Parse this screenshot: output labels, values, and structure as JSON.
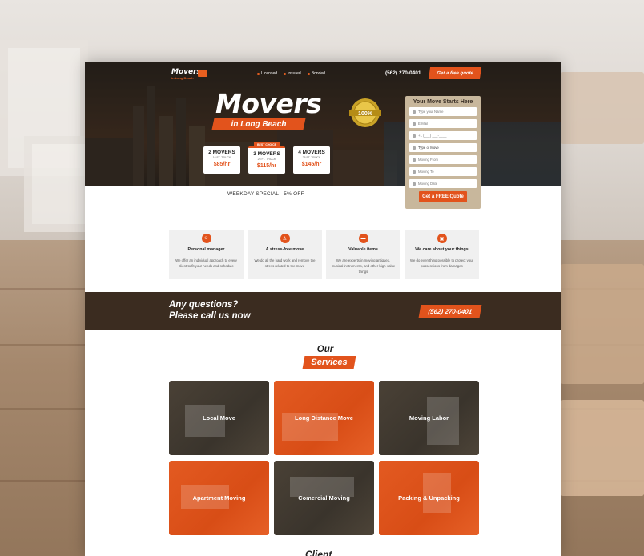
{
  "nav": {
    "logo_title": "Movers",
    "logo_sub": "in Long Beach",
    "tags": [
      "Licensed",
      "Insured",
      "Bonded"
    ],
    "phone": "(562) 270-0401",
    "quote_button": "Get a free quote"
  },
  "hero": {
    "title": "Movers",
    "subtitle": "in Long Beach",
    "badge_text": "100%",
    "special": "WEEKDAY SPECIAL - 5% OFF",
    "prices": [
      {
        "movers": "2 MOVERS",
        "truck": "16 FT. TRUCK",
        "price": "$85/hr",
        "tag": ""
      },
      {
        "movers": "3 MOVERS",
        "truck": "26 FT. TRUCK",
        "price": "$115/hr",
        "tag": "BEST CHOICE"
      },
      {
        "movers": "4 MOVERS",
        "truck": "26 FT. TRUCK",
        "price": "$145/hr",
        "tag": ""
      }
    ]
  },
  "form": {
    "title": "Your Move Starts Here",
    "fields": [
      {
        "placeholder": "Type your Name",
        "icon": "user-icon"
      },
      {
        "placeholder": "E-Mail",
        "icon": "mail-icon"
      },
      {
        "placeholder": "+1 (___) ___-____",
        "icon": "phone-icon"
      },
      {
        "placeholder": "Type of Move",
        "icon": "home-icon"
      },
      {
        "placeholder": "Moving From",
        "icon": "pin-icon"
      },
      {
        "placeholder": "Moving To",
        "icon": "pin-icon"
      },
      {
        "placeholder": "Moving Date",
        "icon": "calendar-icon"
      }
    ],
    "submit": "Get a FREE Quote"
  },
  "features": [
    {
      "title": "Personal manager",
      "text": "We offer an individual approach to every client to fit your needs and schedule",
      "icon": "smile-icon"
    },
    {
      "title": "A stress-free move",
      "text": "We do all the hard work and remove the stress related to the move",
      "icon": "person-icon"
    },
    {
      "title": "Valuable items",
      "text": "We are experts in moving antiques, musical instruments, and other high-value things",
      "icon": "sofa-icon"
    },
    {
      "title": "We care about your things",
      "text": "We do everything possible to protect your possessions from damages",
      "icon": "box-icon"
    }
  ],
  "call": {
    "line1": "Any questions?",
    "line2": "Please call us now",
    "phone": "(562) 270-0401"
  },
  "services": {
    "heading_top": "Our",
    "heading_ribbon": "Services",
    "items": [
      {
        "label": "Local Move",
        "style": "dark"
      },
      {
        "label": "Long Distance Move",
        "style": "orange"
      },
      {
        "label": "Moving Labor",
        "style": "dark"
      },
      {
        "label": "Apartment Moving",
        "style": "orange"
      },
      {
        "label": "Comercial Moving",
        "style": "dark"
      },
      {
        "label": "Packing & Unpacking",
        "style": "orange"
      }
    ]
  },
  "client_heading": "Client",
  "colors": {
    "accent": "#e2531c",
    "band": "#3b2c20",
    "form_bg": "#c8b79c"
  }
}
